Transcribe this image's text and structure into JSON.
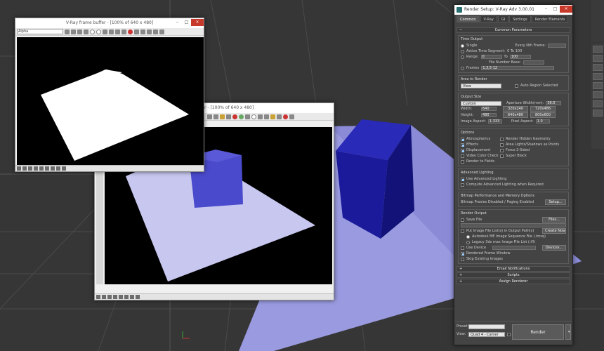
{
  "fb_small": {
    "title": "V-Ray frame buffer - [100% of 640 x 480]",
    "channel": "Alpha"
  },
  "fb_large": {
    "title": "rer - [100% of 640 x 480]"
  },
  "rs": {
    "title": "Render Setup: V-Ray Adv 3.00.01",
    "tabs": [
      "Common",
      "V-Ray",
      "GI",
      "Settings",
      "Render Elements"
    ],
    "common_params": "Common Parameters",
    "time_output": {
      "title": "Time Output",
      "single": "Single",
      "every_nth": "Every Nth Frame:",
      "active_segment": "Active Time Segment:",
      "active_range": "0 To 100",
      "range": "Range:",
      "range_from": "0",
      "to": "To",
      "range_to": "100",
      "file_number_base": "File Number Base:",
      "frames": "Frames",
      "frames_value": "1,3,5-12"
    },
    "area": {
      "title": "Area to Render",
      "value": "View",
      "auto_region": "Auto Region Selected"
    },
    "output_size": {
      "title": "Output Size",
      "preset": "Custom",
      "aperture": "Aperture Width(mm):",
      "aperture_value": "36.0",
      "width": "Width:",
      "width_value": "640",
      "height": "Height:",
      "height_value": "480",
      "p1": "320x240",
      "p2": "720x486",
      "p3": "640x480",
      "p4": "800x600",
      "image_aspect": "Image Aspect:",
      "image_aspect_value": "1.333",
      "pixel_aspect": "Pixel Aspect:",
      "pixel_aspect_value": "1.0"
    },
    "options": {
      "title": "Options",
      "left": [
        "Atmospherics",
        "Effects",
        "Displacement",
        "Video Color Check",
        "Render to Fields"
      ],
      "right": [
        "Render Hidden Geometry",
        "Area Lights/Shadows as Points",
        "Force 2-Sided",
        "Super Black"
      ]
    },
    "adv_lighting": {
      "title": "Advanced Lighting",
      "use": "Use Advanced Lighting",
      "compute": "Compute Advanced Lighting when Required"
    },
    "bitmap": {
      "title": "Bitmap Performance and Memory Options",
      "text": "Bitmap Proxies Disabled / Paging Enabled",
      "setup": "Setup..."
    },
    "render_output": {
      "title": "Render Output",
      "save_file": "Save File",
      "files": "Files...",
      "put_image": "Put Image File List(s) in Output Path(s)",
      "create_now": "Create Now",
      "autodesk": "Autodesk ME Image Sequence File (.imsq)",
      "legacy": "Legacy 3ds max Image File List (.ifl)",
      "use_device": "Use Device",
      "devices": "Devices...",
      "rendered_frame": "Rendered Frame Window",
      "skip": "Skip Existing Images"
    },
    "rollouts": [
      "Email Notifications",
      "Scripts",
      "Assign Renderer"
    ],
    "bottom": {
      "preset_label": "Preset:",
      "preset_value": "",
      "view_label": "View:",
      "view_value": "Quad 4 - Camer",
      "render": "Render"
    }
  },
  "colors": {
    "cube": "#1e1e9a",
    "plane": "#8f8fd8",
    "viewport_bg": "#363636"
  }
}
